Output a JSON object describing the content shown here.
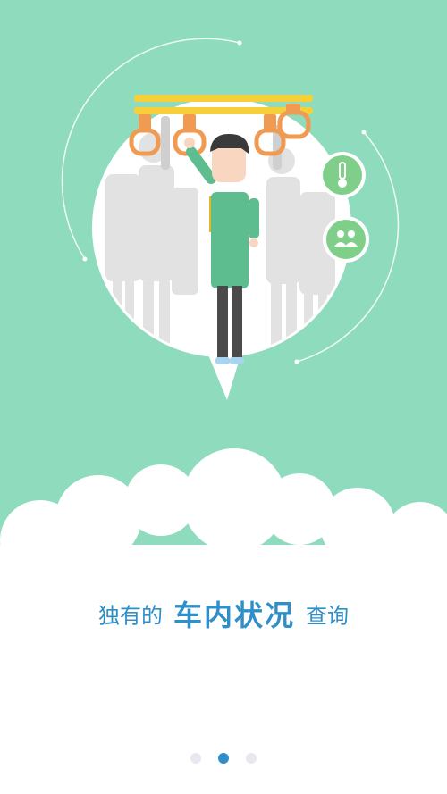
{
  "intro": {
    "caption_prefix": "独有的",
    "caption_highlight": "车内状况",
    "caption_suffix": "查询"
  },
  "pager": {
    "total": 3,
    "active_index": 1
  },
  "icons": {
    "temperature": "thermometer-icon",
    "crowd": "people-icon"
  },
  "colors": {
    "background": "#8fdbbe",
    "accent_blue": "#2f8fc9",
    "handle_orange": "#f19a52",
    "rail_yellow": "#f7cf39",
    "badge_green": "#7fcf8a",
    "shirt_green": "#5ebd8e"
  }
}
